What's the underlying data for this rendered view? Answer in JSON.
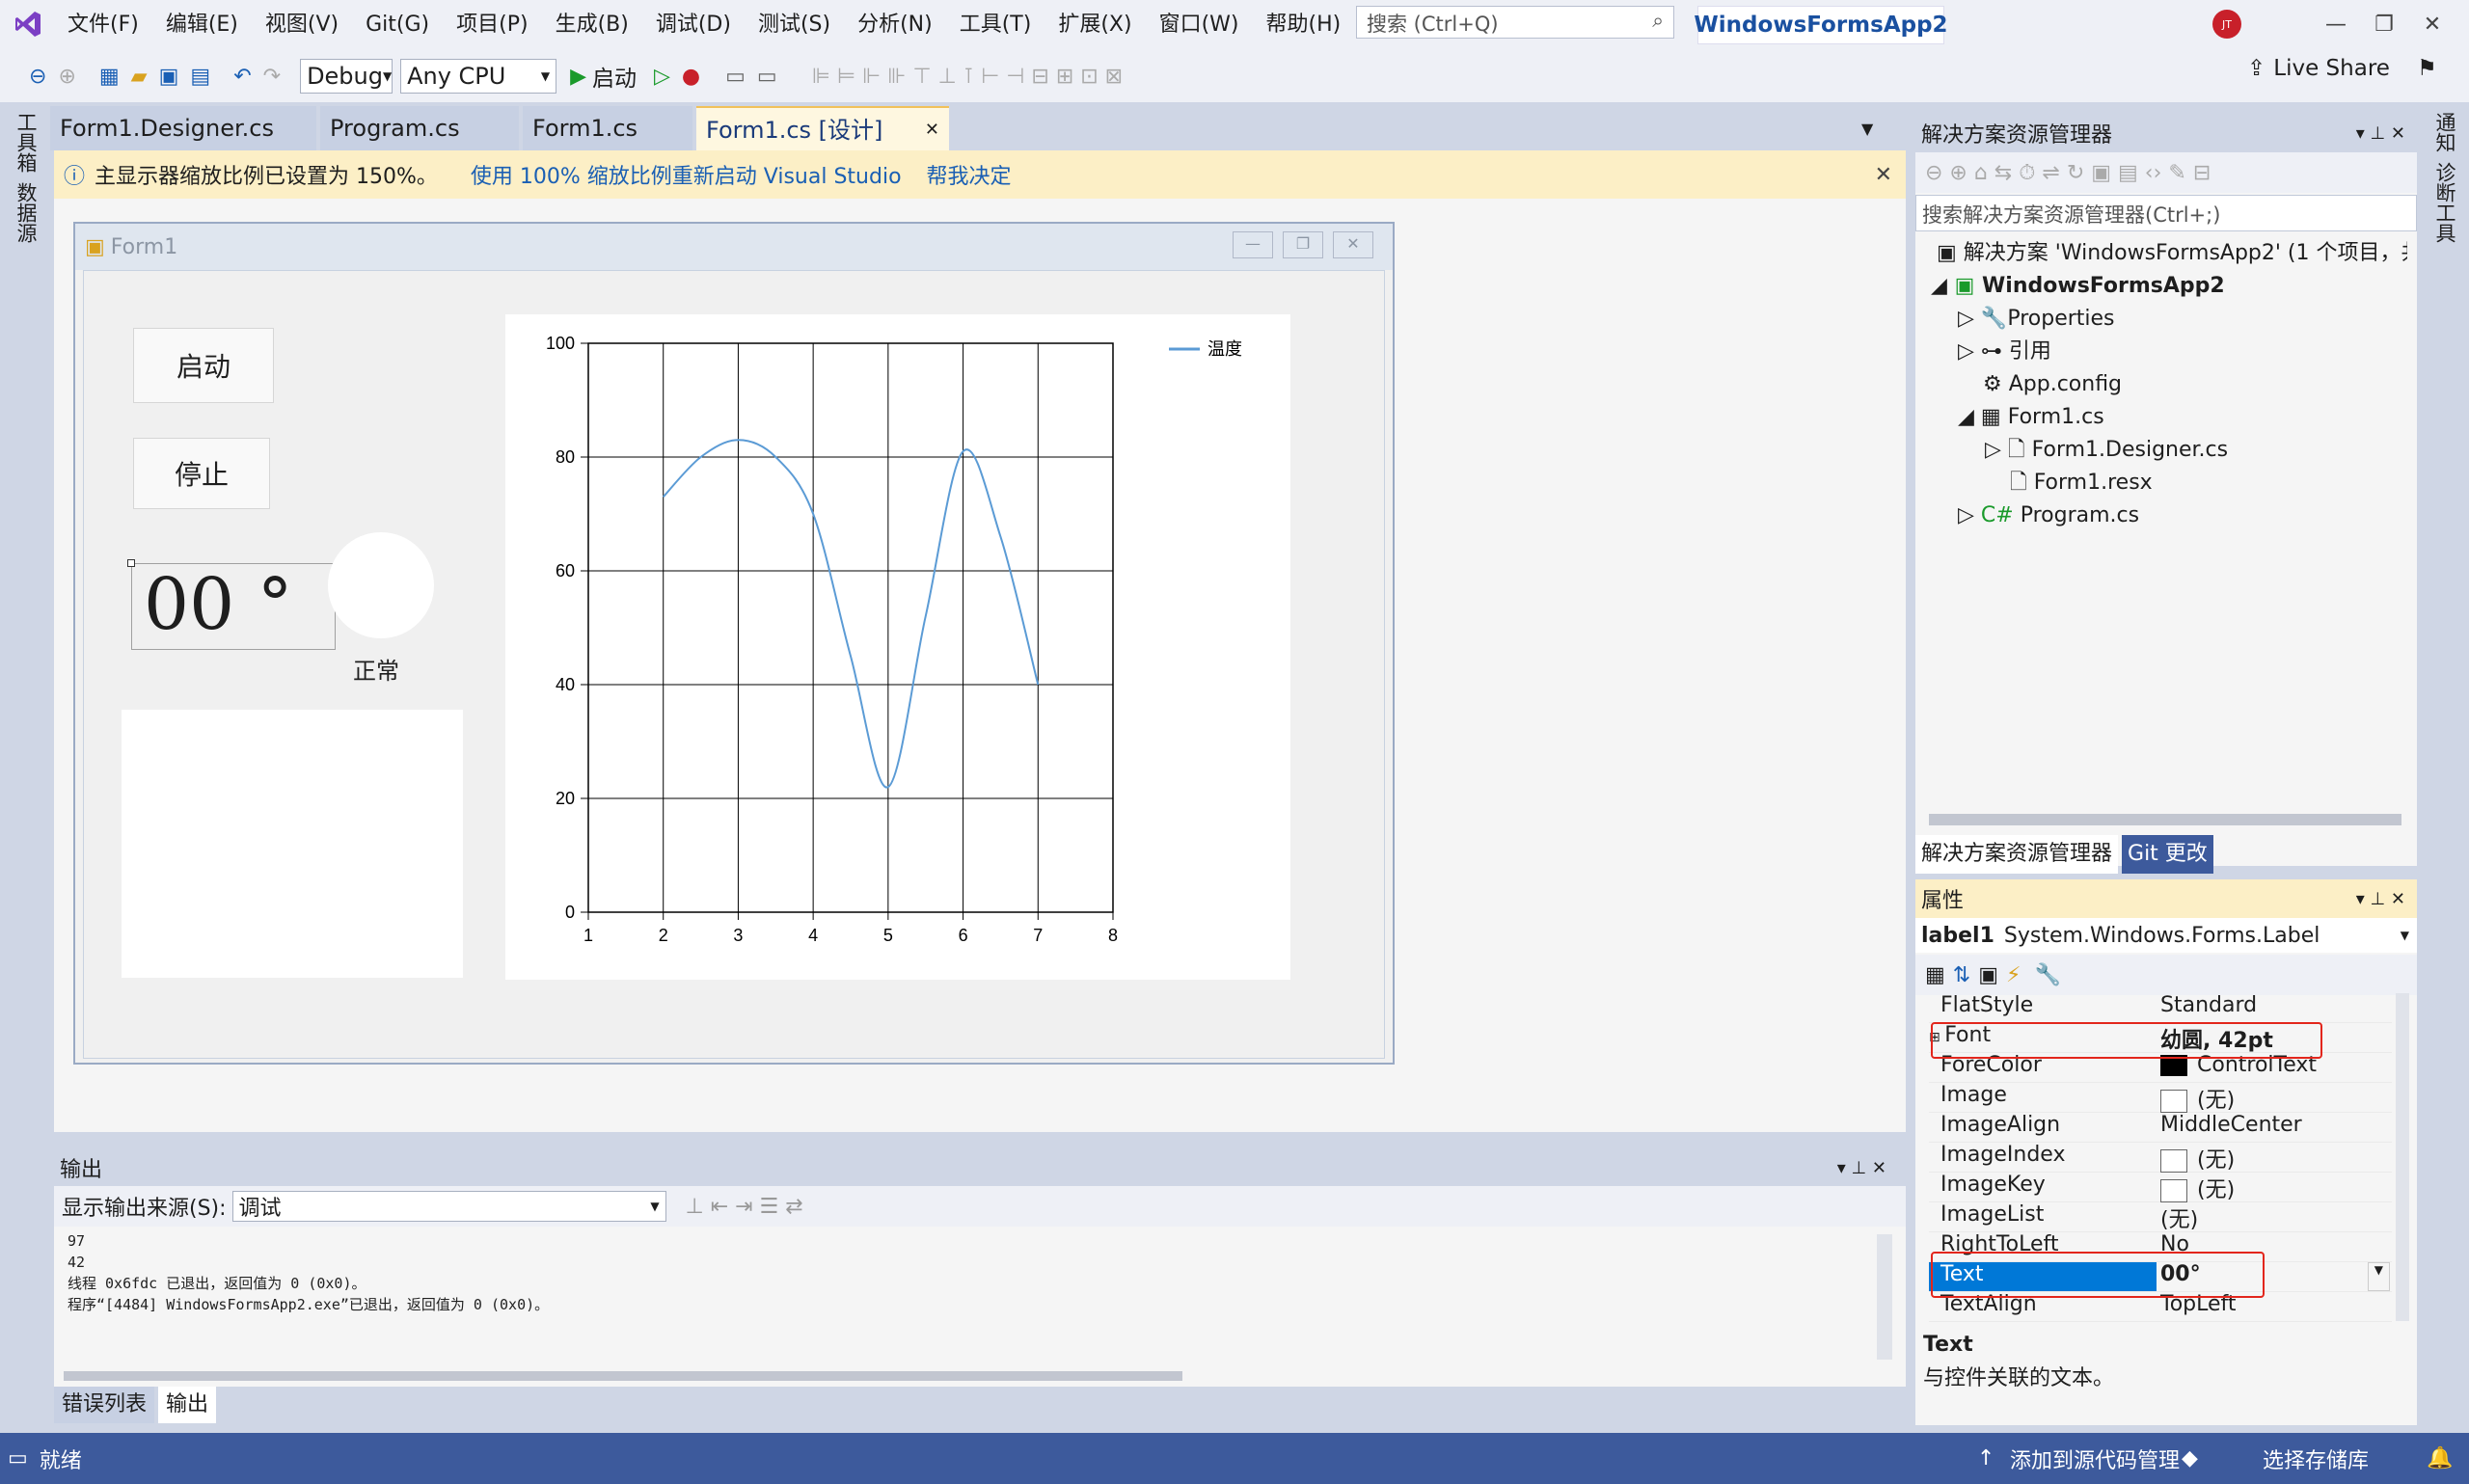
{
  "menu": [
    "文件(F)",
    "编辑(E)",
    "视图(V)",
    "Git(G)",
    "项目(P)",
    "生成(B)",
    "调试(D)",
    "测试(S)",
    "分析(N)",
    "工具(T)",
    "扩展(X)",
    "窗口(W)",
    "帮助(H)"
  ],
  "search": {
    "placeholder": "搜索 (Ctrl+Q)"
  },
  "app_title": "WindowsFormsApp2",
  "avatar": "JT",
  "toolbar": {
    "config": "Debug",
    "platform": "Any CPU",
    "start": "启动",
    "live_share": "Live Share"
  },
  "left_rail": [
    "工具箱",
    "数据源"
  ],
  "right_rail": [
    "通知",
    "诊断工具"
  ],
  "doc_tabs": [
    "Form1.Designer.cs",
    "Program.cs",
    "Form1.cs",
    "Form1.cs [设计]"
  ],
  "info_bar": {
    "message": "主显示器缩放比例已设置为 150%。",
    "link1": "使用 100% 缩放比例重新启动 Visual Studio",
    "link2": "帮我决定"
  },
  "form": {
    "title": "Form1",
    "start_button": "启动",
    "stop_button": "停止",
    "temp_label": "00 °",
    "status_label": "正常"
  },
  "chart_data": {
    "type": "line",
    "x": [
      2,
      2.5,
      3,
      3.5,
      4,
      4.5,
      5,
      5.5,
      6,
      6.5,
      7
    ],
    "series": [
      {
        "name": "温度",
        "values": [
          73,
          80,
          83,
          80,
          70,
          45,
          22,
          52,
          81,
          66,
          40
        ],
        "color": "#5b9bd5"
      }
    ],
    "xlim": [
      1,
      8
    ],
    "ylim": [
      0,
      100
    ],
    "xticks": [
      1,
      2,
      3,
      4,
      5,
      6,
      7,
      8
    ],
    "yticks": [
      0,
      20,
      40,
      60,
      80,
      100
    ],
    "grid": true,
    "legend": "top-right"
  },
  "output": {
    "title": "输出",
    "source_label": "显示输出来源(S):",
    "source_value": "调试",
    "lines": [
      "97",
      "42",
      "",
      "线程 0x6fdc 已退出，返回值为 0 (0x0)。",
      "程序“[4484] WindowsFormsApp2.exe”已退出，返回值为 0 (0x0)。"
    ]
  },
  "bottom_tabs": [
    "错误列表",
    "输出"
  ],
  "solution_explorer": {
    "title": "解决方案资源管理器",
    "search_placeholder": "搜索解决方案资源管理器(Ctrl+;)",
    "tree": [
      {
        "label": "解决方案 'WindowsFormsApp2' (1 个项目，共",
        "level": 0,
        "bold": false
      },
      {
        "label": "WindowsFormsApp2",
        "level": 1,
        "bold": true
      },
      {
        "label": "Properties",
        "level": 2,
        "bold": false
      },
      {
        "label": "引用",
        "level": 2,
        "bold": false
      },
      {
        "label": "App.config",
        "level": 2,
        "bold": false
      },
      {
        "label": "Form1.cs",
        "level": 2,
        "bold": false
      },
      {
        "label": "Form1.Designer.cs",
        "level": 3,
        "bold": false
      },
      {
        "label": "Form1.resx",
        "level": 3,
        "bold": false
      },
      {
        "label": "Program.cs",
        "level": 2,
        "bold": false
      }
    ],
    "tabs": [
      "解决方案资源管理器",
      "Git 更改"
    ]
  },
  "properties": {
    "title": "属性",
    "object": "label1",
    "object_type": "System.Windows.Forms.Label",
    "rows": [
      {
        "name": "FlatStyle",
        "value": "Standard"
      },
      {
        "name": "Font",
        "value": "幼圆, 42pt"
      },
      {
        "name": "ForeColor",
        "value": "ControlText"
      },
      {
        "name": "Image",
        "value": "(无)"
      },
      {
        "name": "ImageAlign",
        "value": "MiddleCenter"
      },
      {
        "name": "ImageIndex",
        "value": "(无)"
      },
      {
        "name": "ImageKey",
        "value": "(无)"
      },
      {
        "name": "ImageList",
        "value": "(无)"
      },
      {
        "name": "RightToLeft",
        "value": "No"
      },
      {
        "name": "Text",
        "value": "00°"
      },
      {
        "name": "TextAlign",
        "value": "TopLeft"
      }
    ],
    "desc_title": "Text",
    "desc_text": "与控件关联的文本。"
  },
  "status_bar": {
    "ready": "就绪",
    "add_source": "添加到源代码管理",
    "select_repo": "选择存储库"
  },
  "colors": {
    "accent": "#3d5a9c",
    "highlight": "#0078d7",
    "red_box": "#e2261c",
    "series": "#5b9bd5"
  }
}
